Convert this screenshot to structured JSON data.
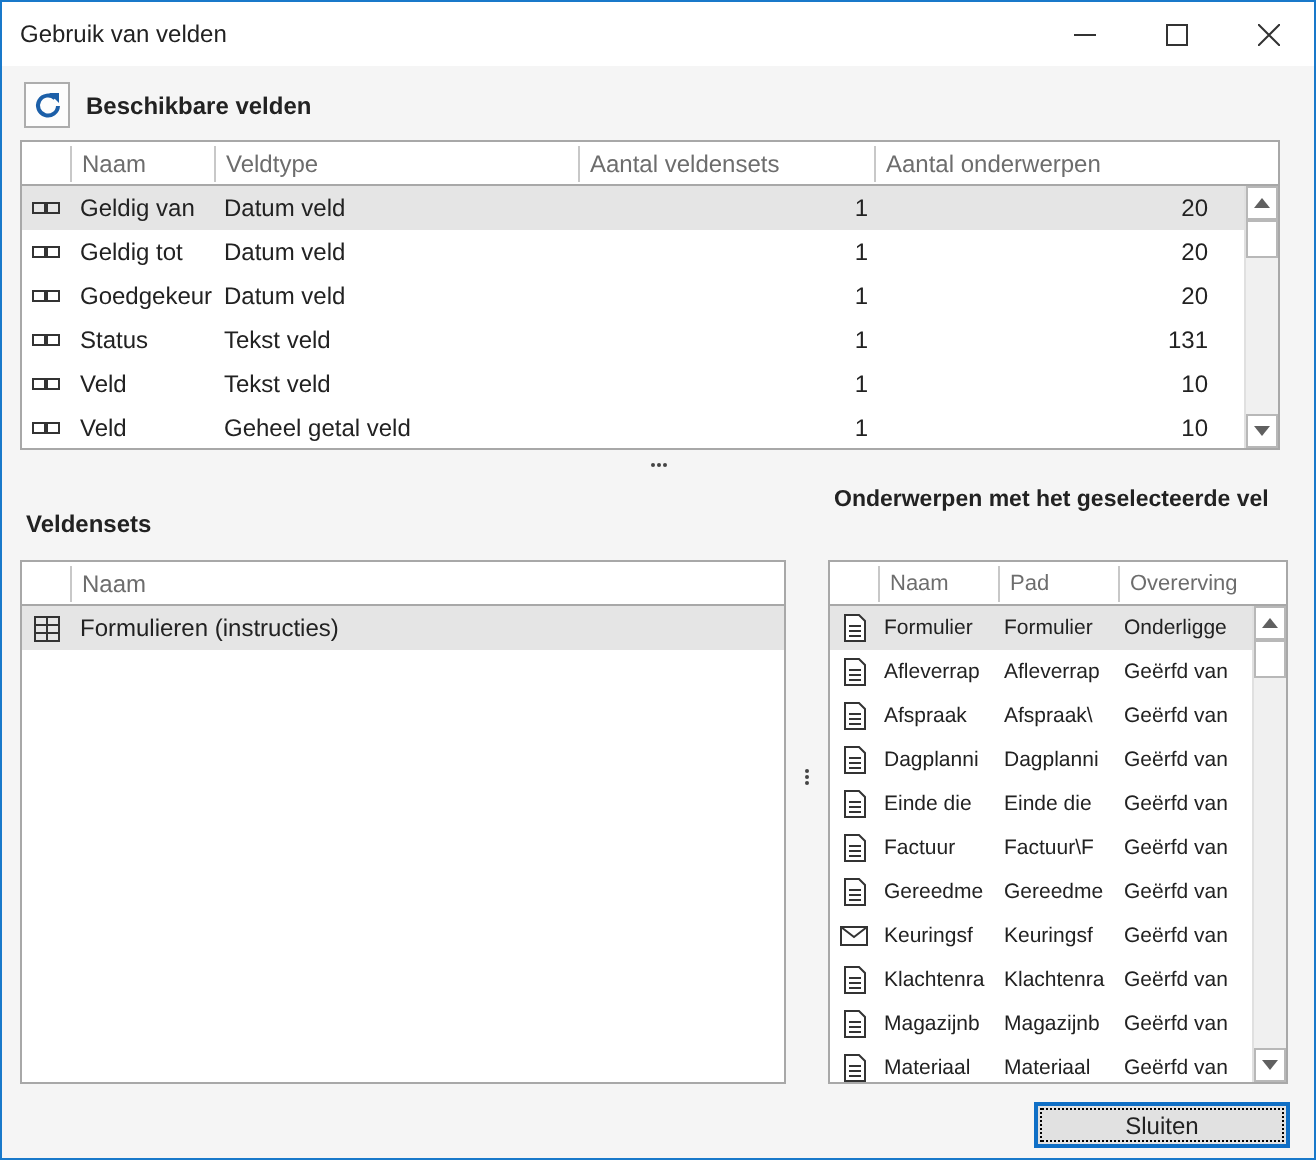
{
  "window": {
    "title": "Gebruik van velden"
  },
  "fields": {
    "title": "Beschikbare velden",
    "columns": [
      "Naam",
      "Veldtype",
      "Aantal veldensets",
      "Aantal onderwerpen"
    ],
    "rows": [
      {
        "name": "Geldig van",
        "type": "Datum veld",
        "sets": "1",
        "subjects": "20",
        "selected": true
      },
      {
        "name": "Geldig tot",
        "type": "Datum veld",
        "sets": "1",
        "subjects": "20",
        "selected": false
      },
      {
        "name": "Goedgekeur",
        "type": "Datum veld",
        "sets": "1",
        "subjects": "20",
        "selected": false
      },
      {
        "name": "Status",
        "type": "Tekst veld",
        "sets": "1",
        "subjects": "131",
        "selected": false
      },
      {
        "name": "Veld",
        "type": "Tekst veld",
        "sets": "1",
        "subjects": "10",
        "selected": false
      },
      {
        "name": "Veld",
        "type": "Geheel getal veld",
        "sets": "1",
        "subjects": "10",
        "selected": false
      }
    ]
  },
  "fieldsets": {
    "title": "Veldensets",
    "columns": [
      "Naam"
    ],
    "rows": [
      {
        "name": "Formulieren (instructies)",
        "selected": true
      }
    ]
  },
  "subjects": {
    "title": "Onderwerpen met het geselecteerde vel",
    "columns": [
      "Naam",
      "Pad",
      "Overerving"
    ],
    "rows": [
      {
        "kind": "document",
        "name": "Formulier",
        "path": "Formulier",
        "inheritance": "Onderligge",
        "selected": true
      },
      {
        "kind": "document",
        "name": "Afleverrap",
        "path": "Afleverrap",
        "inheritance": "Geërfd van",
        "selected": false
      },
      {
        "kind": "document",
        "name": "Afspraak",
        "path": "Afspraak\\",
        "inheritance": "Geërfd van",
        "selected": false
      },
      {
        "kind": "document",
        "name": "Dagplanni",
        "path": "Dagplanni",
        "inheritance": "Geërfd van",
        "selected": false
      },
      {
        "kind": "document",
        "name": "Einde die",
        "path": "Einde die",
        "inheritance": "Geërfd van",
        "selected": false
      },
      {
        "kind": "document",
        "name": "Factuur",
        "path": "Factuur\\F",
        "inheritance": "Geërfd van",
        "selected": false
      },
      {
        "kind": "document",
        "name": "Gereedme",
        "path": "Gereedme",
        "inheritance": "Geërfd van",
        "selected": false
      },
      {
        "kind": "mail",
        "name": "Keuringsf",
        "path": "Keuringsf",
        "inheritance": "Geërfd van",
        "selected": false
      },
      {
        "kind": "document",
        "name": "Klachtenra",
        "path": "Klachtenra",
        "inheritance": "Geërfd van",
        "selected": false
      },
      {
        "kind": "document",
        "name": "Magazijnb",
        "path": "Magazijnb",
        "inheritance": "Geërfd van",
        "selected": false
      },
      {
        "kind": "document",
        "name": "Materiaal",
        "path": "Materiaal",
        "inheritance": "Geërfd van",
        "selected": false
      }
    ]
  },
  "close_button": "Sluiten"
}
